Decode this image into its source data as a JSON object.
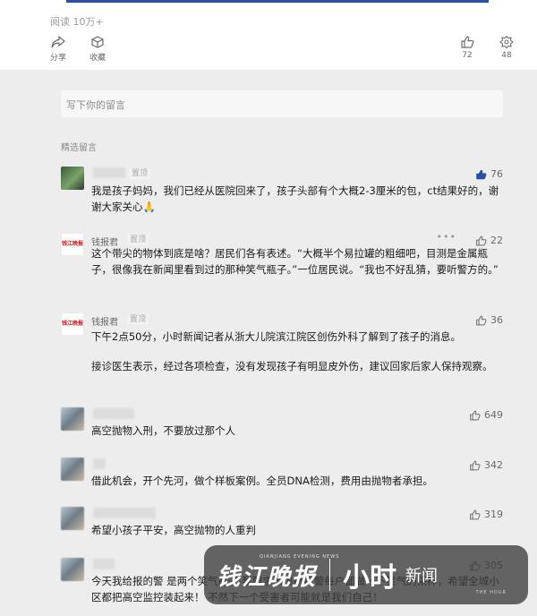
{
  "article_footer": {
    "read_count": "阅读 10万+",
    "share_label": "分享",
    "favorite_label": "收藏",
    "like_count": "72",
    "wow_count": "48"
  },
  "comment_input": {
    "placeholder": "写下你的留言"
  },
  "section_title": "精选留言",
  "comments": [
    {
      "name": "",
      "tag": "置顶",
      "likes": "76",
      "text": "我是孩子妈妈，我们已经从医院回来了，孩子头部有个大概2-3厘米的包，ct结果好的，谢谢大家关心🙏"
    },
    {
      "name": "钱报君",
      "avatar_text": "钱江晚报",
      "tag": "置顶",
      "more": "•••",
      "likes": "22",
      "text": "这个带尖的物体到底是啥？居民们各有表述。“大概半个易拉罐的粗细吧，目测是金属瓶子，很像我在新闻里看到过的那种笑气瓶子。”一位居民说。“我也不好乱猜，要听警方的。”"
    },
    {
      "name": "钱报君",
      "avatar_text": "钱江晚报",
      "tag": "置顶",
      "likes": "36",
      "text": "下午2点50分，小时新闻记者从浙大儿院滨江院区创伤外科了解到了孩子的消息。",
      "text2": "接诊医生表示，经过各项检查，没有发现孩子有明显皮外伤，建议回家后家人保持观察。"
    },
    {
      "name": "",
      "likes": "649",
      "text": "高空抛物入刑，不要放过那个人"
    },
    {
      "name": "",
      "likes": "342",
      "text": "借此机会，开个先河，做个样板案例。全员DNA检测，费用由抛物者承担。"
    },
    {
      "name": "",
      "likes": "319",
      "text": "希望小孩子平安，高空抛物的人重判"
    },
    {
      "name": "",
      "likes": "305",
      "text": "今天我给报的警 是两个笑气瓶子 我要求派出所民警每户都做一下笑气的采样，希望全城小区都把高空监控装起来！ 不然下一个受害者可能就是我们自己！"
    }
  ],
  "watermark": {
    "brand": "钱江晚报",
    "brand_en": "QIANJIANG EVENING NEWS",
    "big": "小时",
    "news": "新闻",
    "sub": "THE HOUR"
  },
  "colors": {
    "accent": "#2a4fa8",
    "background": "#ededed",
    "brand_red": "#c8131a"
  }
}
